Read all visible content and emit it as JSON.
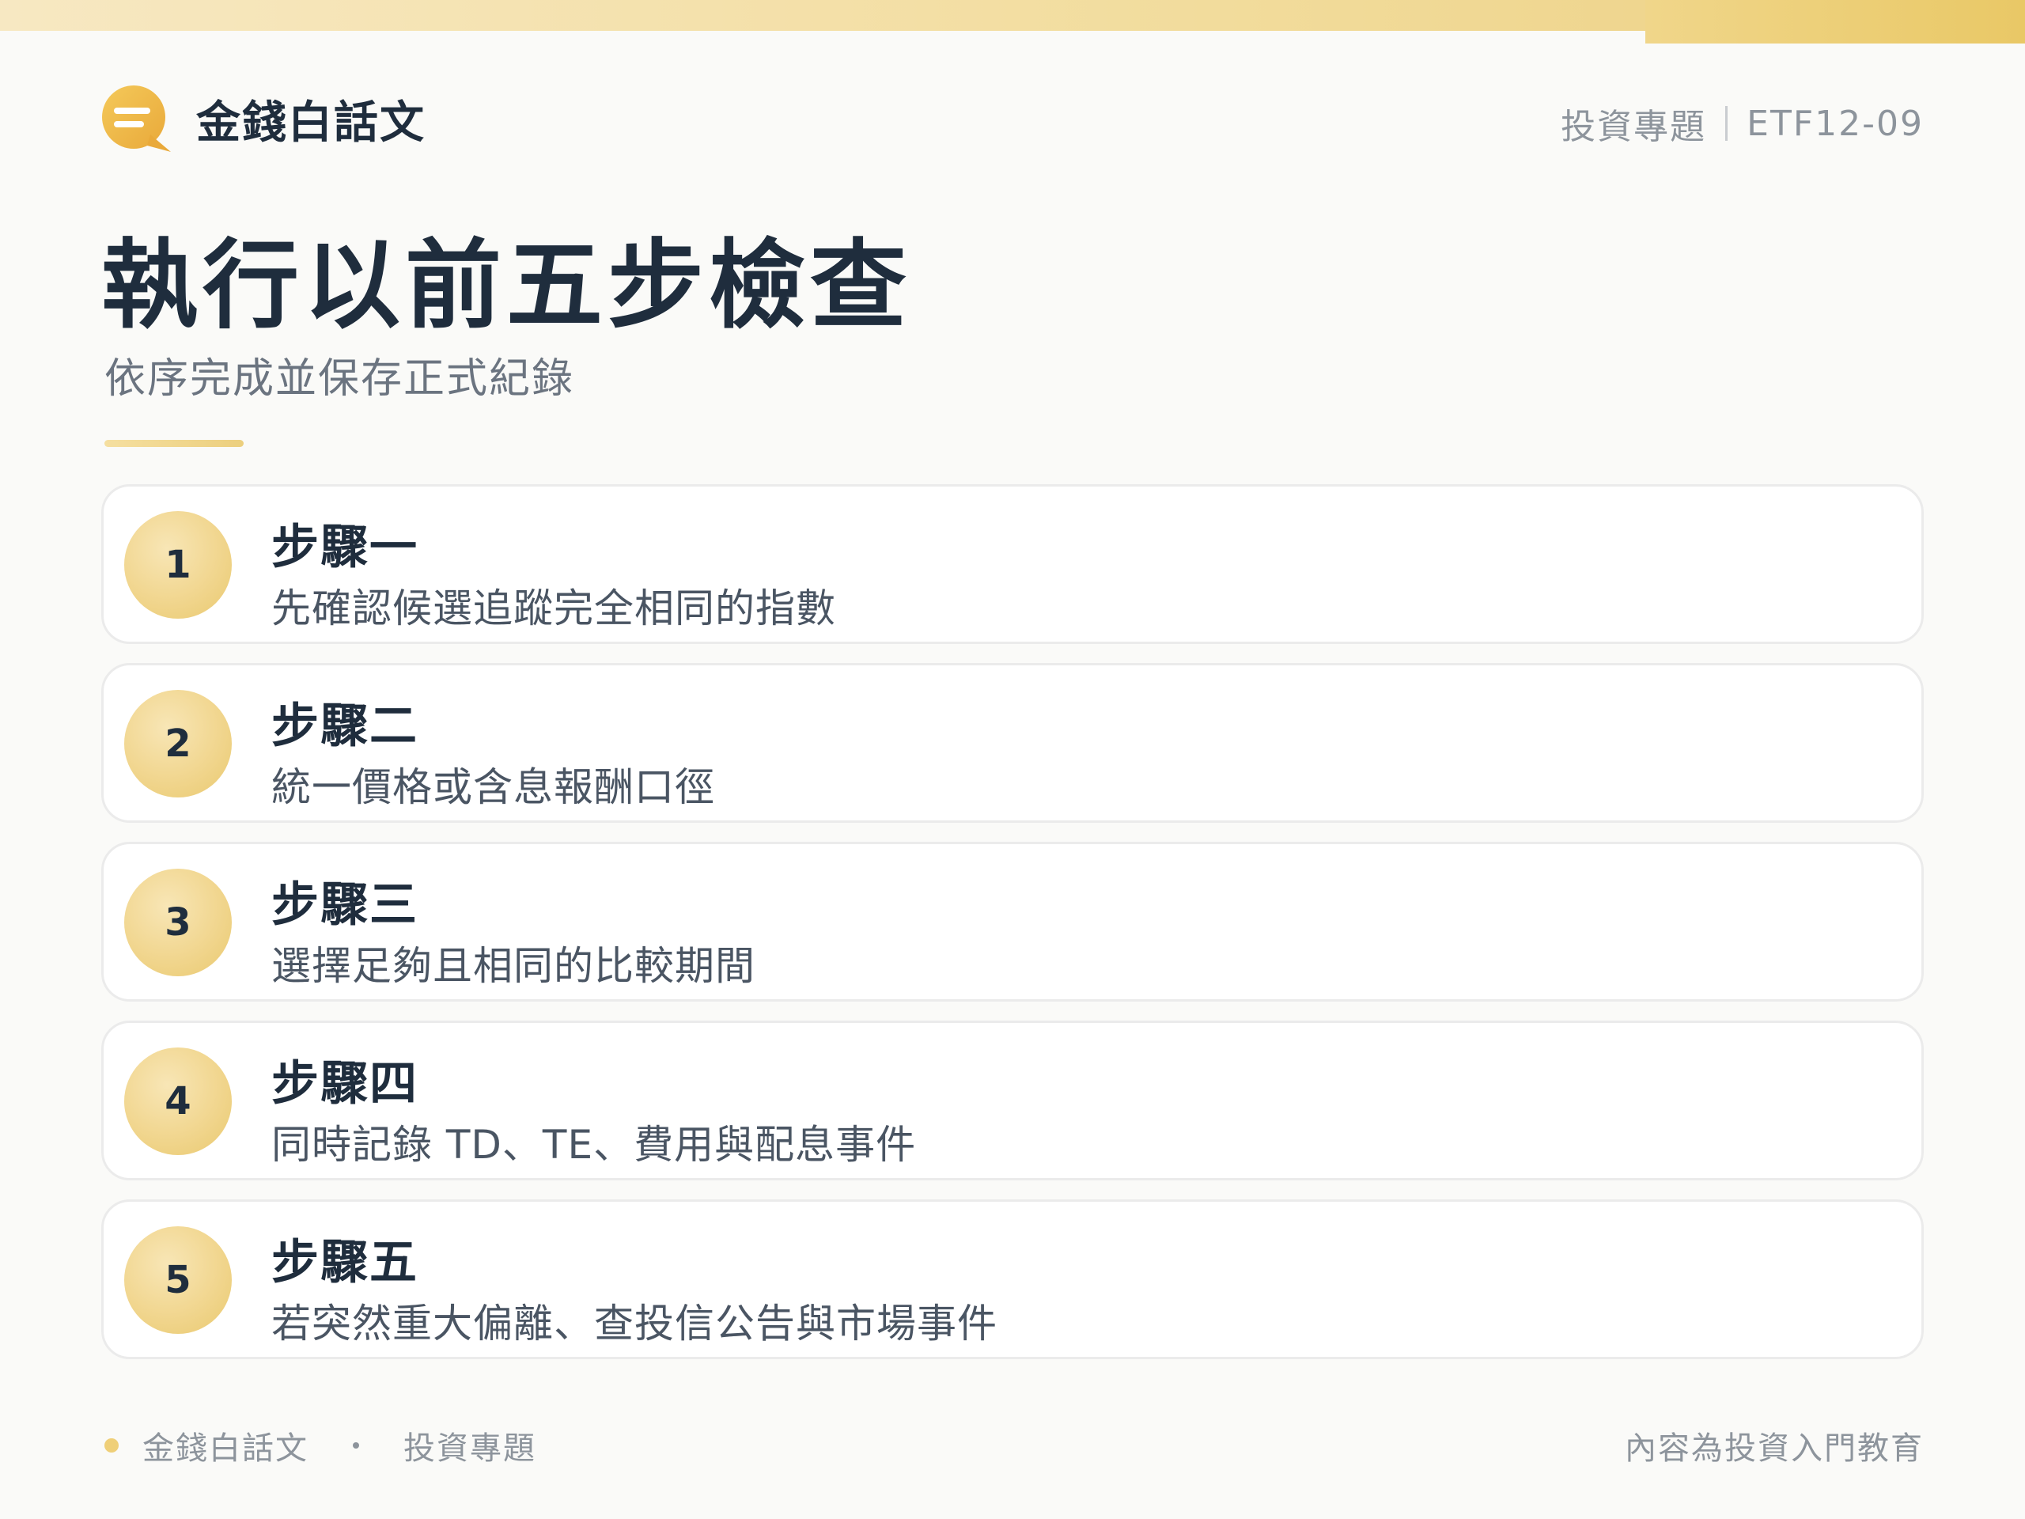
{
  "brand": {
    "name": "金錢白話文"
  },
  "header": {
    "category": "投資專題",
    "code": "ETF12-09"
  },
  "title": "執行以前五步檢查",
  "subtitle": "依序完成並保存正式紀錄",
  "steps": [
    {
      "number": "1",
      "title": "步驟一",
      "desc": "先確認候選追蹤完全相同的指數"
    },
    {
      "number": "2",
      "title": "步驟二",
      "desc": "統一價格或含息報酬口徑"
    },
    {
      "number": "3",
      "title": "步驟三",
      "desc": "選擇足夠且相同的比較期間"
    },
    {
      "number": "4",
      "title": "步驟四",
      "desc": "同時記錄 TD、TE、費用與配息事件"
    },
    {
      "number": "5",
      "title": "步驟五",
      "desc": "若突然重大偏離、查投信公告與市場事件"
    }
  ],
  "footer": {
    "brand": "金錢白話文",
    "category": "投資專題",
    "note": "內容為投資入門教育"
  },
  "colors": {
    "accent": "#efcf78",
    "text": "#1f2d3d",
    "muted": "#8d949c"
  },
  "icons": {
    "logo": "chat-bubble-icon"
  }
}
